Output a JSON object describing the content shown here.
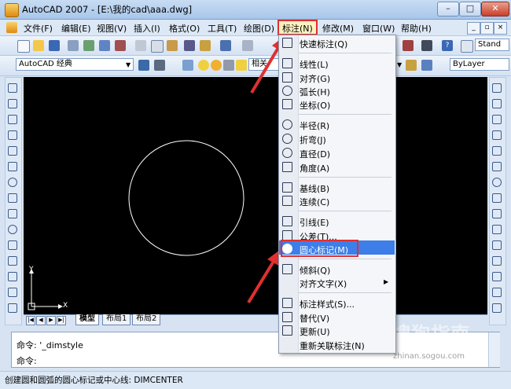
{
  "window": {
    "title": "AutoCAD 2007 - [E:\\我的cad\\aaa.dwg]",
    "minimize": "–",
    "maximize": "□",
    "close": "✕"
  },
  "menubar": {
    "items": [
      "文件(F)",
      "编辑(E)",
      "视图(V)",
      "插入(I)",
      "格式(O)",
      "工具(T)",
      "绘图(D)",
      "标注(N)",
      "修改(M)",
      "窗口(W)",
      "帮助(H)"
    ],
    "doc_controls": [
      "_",
      "▫",
      "×"
    ]
  },
  "toolbar": {
    "workspace": "AutoCAD 经典",
    "text_style": "Stand",
    "layer_text": "相关",
    "color": "ByLayer"
  },
  "dim_menu": {
    "items": [
      {
        "label": "快速标注(Q)",
        "icon": "quick-dimension-icon"
      },
      {
        "label": "线性(L)",
        "icon": "linear-dimension-icon"
      },
      {
        "label": "对齐(G)",
        "icon": "aligned-dimension-icon"
      },
      {
        "label": "弧长(H)",
        "icon": "arc-length-icon"
      },
      {
        "label": "坐标(O)",
        "icon": "ordinate-icon"
      },
      {
        "label": "半径(R)",
        "icon": "radius-icon"
      },
      {
        "label": "折弯(J)",
        "icon": "jogged-icon"
      },
      {
        "label": "直径(D)",
        "icon": "diameter-icon"
      },
      {
        "label": "角度(A)",
        "icon": "angular-icon"
      },
      {
        "label": "基线(B)",
        "icon": "baseline-icon"
      },
      {
        "label": "连续(C)",
        "icon": "continue-icon"
      },
      {
        "label": "引线(E)",
        "icon": "leader-icon"
      },
      {
        "label": "公差(T)...",
        "icon": "tolerance-icon"
      },
      {
        "label": "圆心标记(M)",
        "icon": "center-mark-icon"
      },
      {
        "label": "倾斜(Q)",
        "icon": "oblique-icon"
      },
      {
        "label": "对齐文字(X)",
        "icon": ""
      },
      {
        "label": "标注样式(S)...",
        "icon": "dimension-style-icon"
      },
      {
        "label": "替代(V)",
        "icon": "override-icon"
      },
      {
        "label": "更新(U)",
        "icon": "update-icon"
      },
      {
        "label": "重新关联标注(N)",
        "icon": ""
      }
    ],
    "highlighted": "圆心标记(M)"
  },
  "canvas": {
    "ucs_y": "Y",
    "ucs_x": "X"
  },
  "layout_tabs": [
    "模型",
    "布局1",
    "布局2"
  ],
  "command": {
    "line1": "命令: '_dimstyle",
    "line2": "命令:"
  },
  "status": {
    "text": "创建圆和圆弧的圆心标记或中心线:  DIMCENTER"
  },
  "watermark": {
    "main": "S搜狗指南",
    "sub": "zhinan.sogou.com"
  },
  "colors": {
    "accent_red": "#e03030",
    "highlight_blue": "#3d7ee8",
    "canvas_bg": "#000000"
  }
}
